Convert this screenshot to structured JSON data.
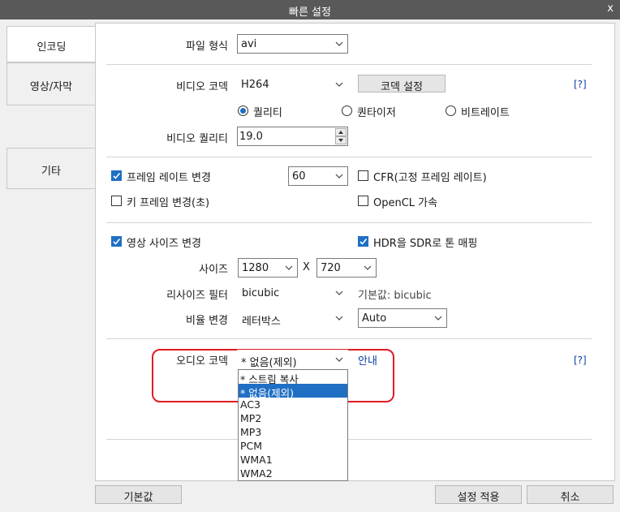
{
  "window": {
    "title": "빠른 설정",
    "close": "x"
  },
  "tabs": [
    {
      "label": "인코딩"
    },
    {
      "label": "영상/자막"
    },
    {
      "label": "기타"
    }
  ],
  "encoding": {
    "file_format_label": "파일 형식",
    "file_format_value": "avi",
    "video_codec_label": "비디오 코덱",
    "video_codec_value": "H264",
    "codec_settings_button": "코덱 설정",
    "help": "[?]",
    "rate_modes": [
      "퀄리티",
      "퀀타이저",
      "비트레이트"
    ],
    "video_quality_label": "비디오 퀄리티",
    "video_quality_value": "19.0"
  },
  "framerate": {
    "change_label": "프레임 레이트 변경",
    "value": "60",
    "cfr_label": "CFR(고정 프레임 레이트)",
    "keyframe_label": "키 프레임 변경(초)",
    "opencl_label": "OpenCL 가속"
  },
  "resize": {
    "change_label": "영상 사이즈 변경",
    "hdr_label": "HDR을 SDR로 톤 매핑",
    "size_label": "사이즈",
    "width": "1280",
    "x_sep": "X",
    "height": "720",
    "filter_label": "리사이즈 필터",
    "filter_value": "bicubic",
    "filter_default": "기본값: bicubic",
    "ratio_label": "비율 변경",
    "ratio_value": "레터박스",
    "ratio_mode": "Auto"
  },
  "audio": {
    "codec_label": "오디오 코덱",
    "codec_value": "* 없음(제외)",
    "guide_link": "안내",
    "help": "[?]",
    "options": [
      "* 스트림 복사",
      "* 없음(제외)",
      "AC3",
      "MP2",
      "MP3",
      "PCM",
      "WMA1",
      "WMA2"
    ]
  },
  "footer": {
    "default_button": "기본값",
    "apply_button": "설정 적용",
    "cancel_button": "취소"
  },
  "colors": {
    "accent": "#1f6fc4",
    "titlebar": "#595959",
    "highlight": "#e01b24",
    "link": "#0b3fa8"
  }
}
